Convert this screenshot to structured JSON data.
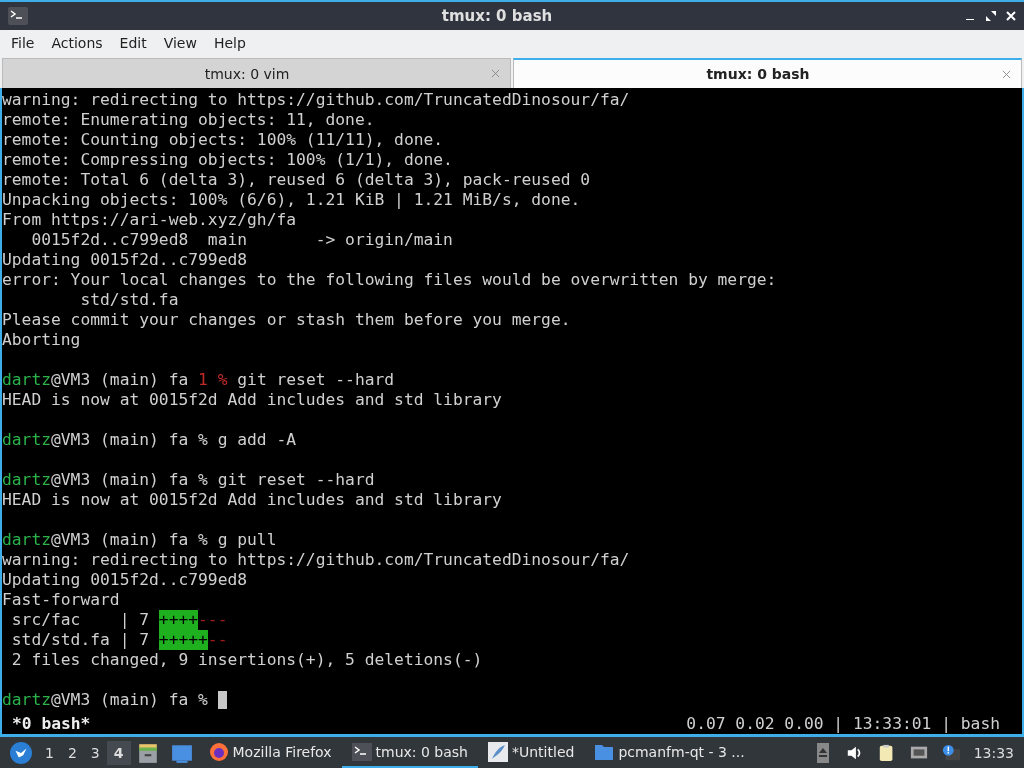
{
  "window": {
    "title": "tmux: 0 bash"
  },
  "menu": [
    "File",
    "Actions",
    "Edit",
    "View",
    "Help"
  ],
  "tabs": [
    {
      "label": "tmux: 0 vim",
      "selected": false
    },
    {
      "label": "tmux: 0 bash",
      "selected": true
    }
  ],
  "terminal": {
    "lines": [
      {
        "kind": "text",
        "segments": [
          {
            "kind": "plain",
            "text": "warning: redirecting to https://github.com/TruncatedDinosour/fa/"
          }
        ]
      },
      {
        "kind": "text",
        "segments": [
          {
            "kind": "plain",
            "text": "remote: Enumerating objects: 11, done."
          }
        ]
      },
      {
        "kind": "text",
        "segments": [
          {
            "kind": "plain",
            "text": "remote: Counting objects: 100% (11/11), done."
          }
        ]
      },
      {
        "kind": "text",
        "segments": [
          {
            "kind": "plain",
            "text": "remote: Compressing objects: 100% (1/1), done."
          }
        ]
      },
      {
        "kind": "text",
        "segments": [
          {
            "kind": "plain",
            "text": "remote: Total 6 (delta 3), reused 6 (delta 3), pack-reused 0"
          }
        ]
      },
      {
        "kind": "text",
        "segments": [
          {
            "kind": "plain",
            "text": "Unpacking objects: 100% (6/6), 1.21 KiB | 1.21 MiB/s, done."
          }
        ]
      },
      {
        "kind": "text",
        "segments": [
          {
            "kind": "plain",
            "text": "From https://ari-web.xyz/gh/fa"
          }
        ]
      },
      {
        "kind": "text",
        "segments": [
          {
            "kind": "plain",
            "text": "   0015f2d..c799ed8  main       -> origin/main"
          }
        ]
      },
      {
        "kind": "text",
        "segments": [
          {
            "kind": "plain",
            "text": "Updating 0015f2d..c799ed8"
          }
        ]
      },
      {
        "kind": "text",
        "segments": [
          {
            "kind": "plain",
            "text": "error: Your local changes to the following files would be overwritten by merge:"
          }
        ]
      },
      {
        "kind": "text",
        "segments": [
          {
            "kind": "plain",
            "text": "        std/std.fa"
          }
        ]
      },
      {
        "kind": "text",
        "segments": [
          {
            "kind": "plain",
            "text": "Please commit your changes or stash them before you merge."
          }
        ]
      },
      {
        "kind": "text",
        "segments": [
          {
            "kind": "plain",
            "text": "Aborting"
          }
        ]
      },
      {
        "kind": "blank"
      },
      {
        "kind": "text",
        "segments": [
          {
            "kind": "user",
            "text": "dartz"
          },
          {
            "kind": "plain",
            "text": "@VM3 (main) fa "
          },
          {
            "kind": "status",
            "text": "1 %"
          },
          {
            "kind": "plain",
            "text": " git reset --hard"
          }
        ]
      },
      {
        "kind": "text",
        "segments": [
          {
            "kind": "plain",
            "text": "HEAD is now at 0015f2d Add includes and std library"
          }
        ]
      },
      {
        "kind": "blank"
      },
      {
        "kind": "text",
        "segments": [
          {
            "kind": "user",
            "text": "dartz"
          },
          {
            "kind": "plain",
            "text": "@VM3 (main) fa % g add -A"
          }
        ]
      },
      {
        "kind": "blank"
      },
      {
        "kind": "text",
        "segments": [
          {
            "kind": "user",
            "text": "dartz"
          },
          {
            "kind": "plain",
            "text": "@VM3 (main) fa % git reset --hard"
          }
        ]
      },
      {
        "kind": "text",
        "segments": [
          {
            "kind": "plain",
            "text": "HEAD is now at 0015f2d Add includes and std library"
          }
        ]
      },
      {
        "kind": "blank"
      },
      {
        "kind": "text",
        "segments": [
          {
            "kind": "user",
            "text": "dartz"
          },
          {
            "kind": "plain",
            "text": "@VM3 (main) fa % g pull"
          }
        ]
      },
      {
        "kind": "text",
        "segments": [
          {
            "kind": "plain",
            "text": "warning: redirecting to https://github.com/TruncatedDinosour/fa/"
          }
        ]
      },
      {
        "kind": "text",
        "segments": [
          {
            "kind": "plain",
            "text": "Updating 0015f2d..c799ed8"
          }
        ]
      },
      {
        "kind": "text",
        "segments": [
          {
            "kind": "plain",
            "text": "Fast-forward"
          }
        ]
      },
      {
        "kind": "text",
        "segments": [
          {
            "kind": "plain",
            "text": " src/fac    | 7 "
          },
          {
            "kind": "added",
            "text": "++++"
          },
          {
            "kind": "removed",
            "text": "---"
          }
        ]
      },
      {
        "kind": "text",
        "segments": [
          {
            "kind": "plain",
            "text": " std/std.fa | 7 "
          },
          {
            "kind": "added",
            "text": "+++++"
          },
          {
            "kind": "removed",
            "text": "--"
          }
        ]
      },
      {
        "kind": "text",
        "segments": [
          {
            "kind": "plain",
            "text": " 2 files changed, 9 insertions(+), 5 deletions(-)"
          }
        ]
      },
      {
        "kind": "blank"
      },
      {
        "kind": "prompt",
        "segments": [
          {
            "kind": "user",
            "text": "dartz"
          },
          {
            "kind": "plain",
            "text": "@VM3 (main) fa %"
          }
        ]
      }
    ],
    "status_bar": {
      "window": "*0 bash*",
      "info": "0.07 0.02 0.00 | 13:33:01 | bash"
    }
  },
  "taskbar": {
    "workspaces": [
      {
        "label": "1",
        "selected": false
      },
      {
        "label": "2",
        "selected": false
      },
      {
        "label": "3",
        "selected": false
      },
      {
        "label": "4",
        "selected": true
      }
    ],
    "tasks": [
      {
        "kind": "firefox",
        "label": "Mozilla Firefox",
        "selected": false
      },
      {
        "kind": "terminal",
        "label": "tmux: 0 bash",
        "selected": true
      },
      {
        "kind": "editor",
        "label": "*Untitled",
        "selected": false
      },
      {
        "kind": "folder",
        "label": "pcmanfm-qt - 3 ...",
        "selected": false
      }
    ],
    "clock": "13:33"
  }
}
